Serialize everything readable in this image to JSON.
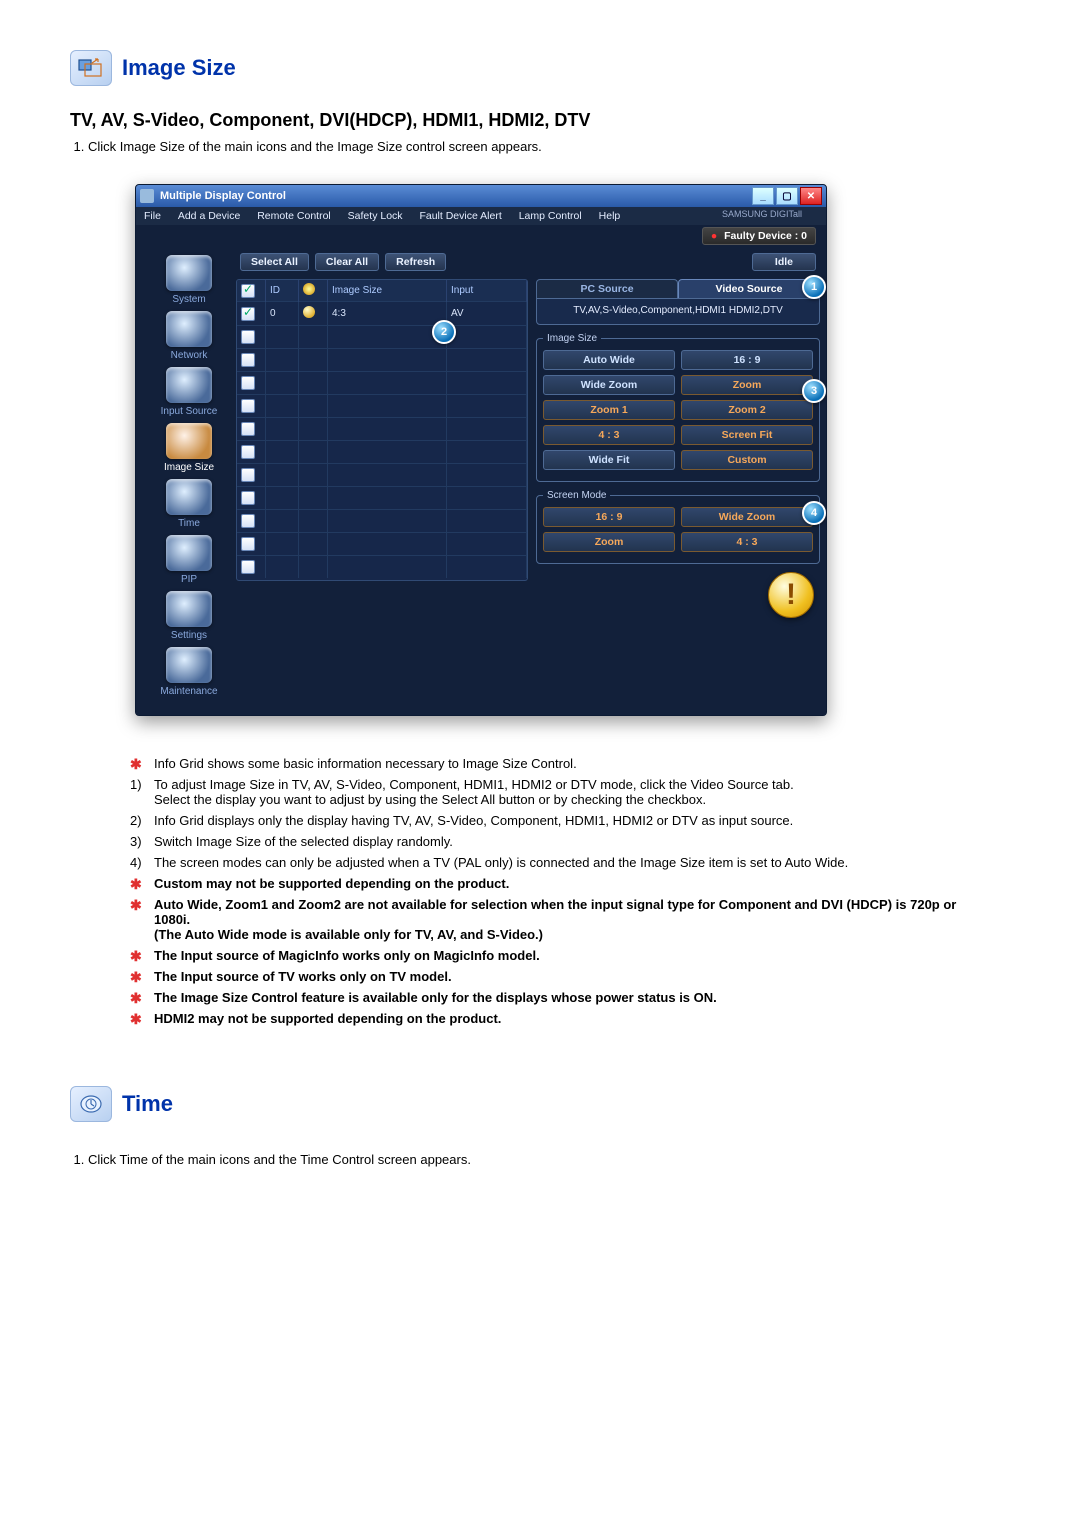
{
  "section1": {
    "title": "Image Size",
    "subheading": "TV, AV, S-Video, Component, DVI(HDCP), HDMI1, HDMI2, DTV",
    "step1_label": "1.",
    "step1_text": "Click Image Size of the main icons and the Image Size control screen appears."
  },
  "window": {
    "title": "Multiple Display Control",
    "menubar": [
      "File",
      "Add a Device",
      "Remote Control",
      "Safety Lock",
      "Fault Device Alert",
      "Lamp Control",
      "Help"
    ],
    "brand": "SAMSUNG DIGITall",
    "faulty_label": "Faulty Device : 0",
    "toolbar": {
      "select_all": "Select All",
      "clear_all": "Clear All",
      "refresh": "Refresh",
      "idle": "Idle"
    },
    "sidebar": [
      {
        "label": "System"
      },
      {
        "label": "Network"
      },
      {
        "label": "Input Source"
      },
      {
        "label": "Image Size",
        "active": true
      },
      {
        "label": "Time"
      },
      {
        "label": "PIP"
      },
      {
        "label": "Settings"
      },
      {
        "label": "Maintenance"
      }
    ],
    "grid": {
      "headers": {
        "checkbox": "",
        "id": "ID",
        "status": "",
        "image_size": "Image Size",
        "input": "Input"
      },
      "row": {
        "checked": true,
        "id": "0",
        "image_size": "4:3",
        "input": "AV"
      }
    },
    "tabs": {
      "pc_source": "PC Source",
      "video_source": "Video Source"
    },
    "video_modes": "TV,AV,S-Video,Component,HDMI1 HDMI2,DTV",
    "image_size_legend": "Image Size",
    "image_size_buttons": [
      [
        "Auto Wide",
        "16 : 9"
      ],
      [
        "Wide Zoom",
        "Zoom"
      ],
      [
        "Zoom 1",
        "Zoom 2"
      ],
      [
        "4 : 3",
        "Screen Fit"
      ],
      [
        "Wide Fit",
        "Custom"
      ]
    ],
    "screen_mode_legend": "Screen Mode",
    "screen_mode_buttons": [
      [
        "16 : 9",
        "Wide Zoom"
      ],
      [
        "Zoom",
        "4 : 3"
      ]
    ],
    "callouts": {
      "c1": "1",
      "c2": "2",
      "c3": "3",
      "c4": "4"
    }
  },
  "notes": {
    "star1": "Info Grid shows some basic information necessary to Image Size Control.",
    "n1": "To adjust Image Size in TV, AV, S-Video, Component, HDMI1, HDMI2 or DTV mode, click the Video Source tab.",
    "n1b": "Select the display you want to adjust by using the Select All button or by checking the checkbox.",
    "n2": "Info Grid displays only the display having TV, AV, S-Video, Component, HDMI1, HDMI2 or DTV as input source.",
    "n3": "Switch Image Size of the selected display randomly.",
    "n4": "The screen modes can only be adjusted when a TV (PAL only) is connected and the Image Size item is set to Auto Wide.",
    "star2": "Custom may not be supported depending on the product.",
    "star3a": "Auto Wide, Zoom1 and Zoom2 are not available for selection when the input signal type for Component and DVI (HDCP) is 720p or 1080i.",
    "star3b": "(The Auto Wide mode is available only for TV, AV, and S-Video.)",
    "star4": "The Input source of MagicInfo works only on MagicInfo model.",
    "star5": "The Input source of TV works only on TV model.",
    "star6": "The Image Size Control feature is available only for the displays whose power status is ON.",
    "star7": "HDMI2 may not be supported depending on the product."
  },
  "section2": {
    "title": "Time",
    "step1_label": "1.",
    "step1_text": "Click Time of the main icons and the Time Control screen appears."
  }
}
